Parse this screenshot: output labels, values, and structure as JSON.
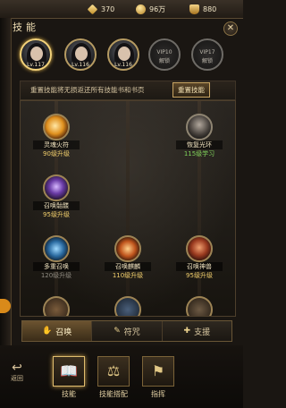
{
  "currency": {
    "gems": "370",
    "coins": "96万",
    "ingots": "880"
  },
  "title": "技能",
  "close_icon": "close-icon",
  "heroes": [
    {
      "level": "Lv.117",
      "selected": true
    },
    {
      "level": "Lv.116",
      "selected": false
    },
    {
      "level": "Lv.116",
      "selected": false
    },
    {
      "vip": "VIP10",
      "state": "解锁"
    },
    {
      "vip": "VIP17",
      "state": "解锁"
    }
  ],
  "reset": {
    "text": "重置技能将无损返还所有技能书和书页",
    "button": "重置技能"
  },
  "skills": [
    {
      "name": "灵魂火符",
      "sub": "90级升级",
      "sub_color": "#f2cf6c"
    },
    {
      "name": "恢复光环",
      "sub": "115级学习",
      "sub_color": "#7fd15a"
    },
    {
      "name": "召唤骷髅",
      "sub": "95级升级",
      "sub_color": "#f2cf6c"
    },
    {
      "name": "多重召唤",
      "sub": "120级升级",
      "sub_color": "#8e8a80"
    },
    {
      "name": "召唤麒麟",
      "sub": "110级升级",
      "sub_color": "#f2cf6c"
    },
    {
      "name": "召唤神兽",
      "sub": "95级升级",
      "sub_color": "#f2cf6c"
    }
  ],
  "tabs": [
    {
      "label": "召唤",
      "icon": "summon-icon",
      "active": true
    },
    {
      "label": "符咒",
      "icon": "talisman-icon",
      "active": false
    },
    {
      "label": "支援",
      "icon": "support-icon",
      "active": false
    }
  ],
  "bottom": {
    "back": "返回",
    "nav": [
      {
        "label": "技能",
        "icon": "skill-book-icon",
        "active": true
      },
      {
        "label": "技能搭配",
        "icon": "skill-combo-icon",
        "active": false
      },
      {
        "label": "指挥",
        "icon": "command-icon",
        "active": false
      }
    ]
  }
}
